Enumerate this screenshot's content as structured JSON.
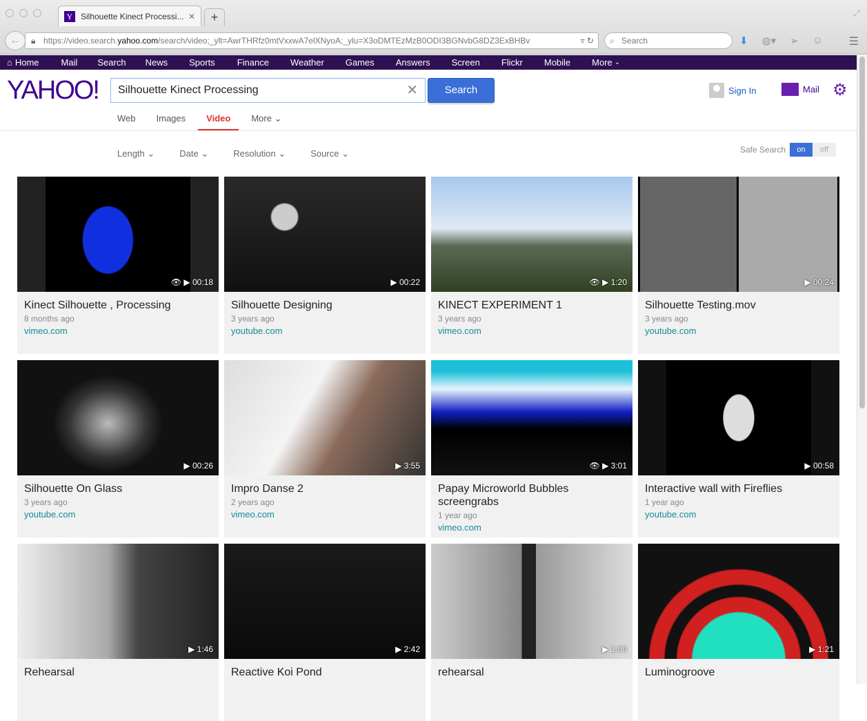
{
  "browser": {
    "tab_title": "Silhouette Kinect Processi...",
    "url_prefix": "https://video.search.",
    "url_domain": "yahoo.com",
    "url_path": "/search/video;_ylt=AwrTHRfz0mtVxxwA7elXNyoA;_ylu=X3oDMTEzMzB0ODI3BGNvbG8DZ3ExBHBv",
    "search_placeholder": "Search"
  },
  "nav": {
    "items": [
      "Home",
      "Mail",
      "Search",
      "News",
      "Sports",
      "Finance",
      "Weather",
      "Games",
      "Answers",
      "Screen",
      "Flickr",
      "Mobile",
      "More"
    ]
  },
  "header": {
    "logo": "YAHOO!",
    "query": "Silhouette Kinect Processing",
    "search_button": "Search",
    "sign_in": "Sign In",
    "mail": "Mail"
  },
  "vertical_tabs": [
    "Web",
    "Images",
    "Video",
    "More"
  ],
  "active_tab": "Video",
  "filters": [
    "Length",
    "Date",
    "Resolution",
    "Source"
  ],
  "safe_search": {
    "label": "Safe Search",
    "on": "on",
    "off": "off",
    "state": "on"
  },
  "colors": {
    "nav_bg": "#2d1152",
    "brand": "#400090",
    "accent": "#3b6fd8",
    "active_tab": "#e0352b",
    "source_link": "#138a99"
  },
  "results": [
    {
      "title": "Kinect Silhouette , Processing",
      "age": "8 months ago",
      "source": "vimeo.com",
      "duration": "00:18",
      "viewed": true
    },
    {
      "title": "Silhouette Designing",
      "age": "3 years ago",
      "source": "youtube.com",
      "duration": "00:22",
      "viewed": false
    },
    {
      "title": "KINECT EXPERIMENT 1",
      "age": "3 years ago",
      "source": "vimeo.com",
      "duration": "1:20",
      "viewed": true
    },
    {
      "title": "Silhouette Testing.mov",
      "age": "3 years ago",
      "source": "youtube.com",
      "duration": "00:24",
      "viewed": false
    },
    {
      "title": "Silhouette On Glass",
      "age": "3 years ago",
      "source": "youtube.com",
      "duration": "00:26",
      "viewed": false
    },
    {
      "title": "Impro Danse 2",
      "age": "2 years ago",
      "source": "vimeo.com",
      "duration": "3:55",
      "viewed": false
    },
    {
      "title": "Papay Microworld Bubbles screengrabs",
      "age": "1 year ago",
      "source": "vimeo.com",
      "duration": "3:01",
      "viewed": true
    },
    {
      "title": "Interactive wall with Fireflies",
      "age": "1 year ago",
      "source": "youtube.com",
      "duration": "00:58",
      "viewed": false
    },
    {
      "title": "Rehearsal",
      "duration": "1:46",
      "viewed": false
    },
    {
      "title": "Reactive Koi Pond",
      "duration": "2:42",
      "viewed": false
    },
    {
      "title": "rehearsal",
      "duration": "1:00",
      "viewed": false
    },
    {
      "title": "Luminogroove",
      "duration": "1:21",
      "viewed": false
    }
  ]
}
